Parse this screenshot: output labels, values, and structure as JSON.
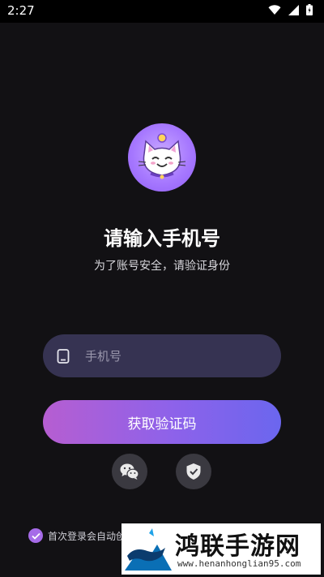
{
  "status_bar": {
    "time": "2:27"
  },
  "header": {
    "title": "请输入手机号",
    "subtitle": "为了账号安全，请验证身份"
  },
  "phone_input": {
    "value": "",
    "placeholder": "手机号"
  },
  "primary_button": {
    "label": "获取验证码"
  },
  "alt_login": [
    "wechat-icon",
    "shield-check-icon"
  ],
  "agreement": {
    "checked": true,
    "text": "首次登录会自动创"
  },
  "watermark": {
    "name": "鸿联手游网",
    "url": "www.henanhonglian95.com"
  },
  "colors": {
    "background": "#121114",
    "input_bg": "#363352",
    "gradient_start": "#b65ed1",
    "gradient_end": "#6b66ee",
    "accent": "#a66be8"
  }
}
